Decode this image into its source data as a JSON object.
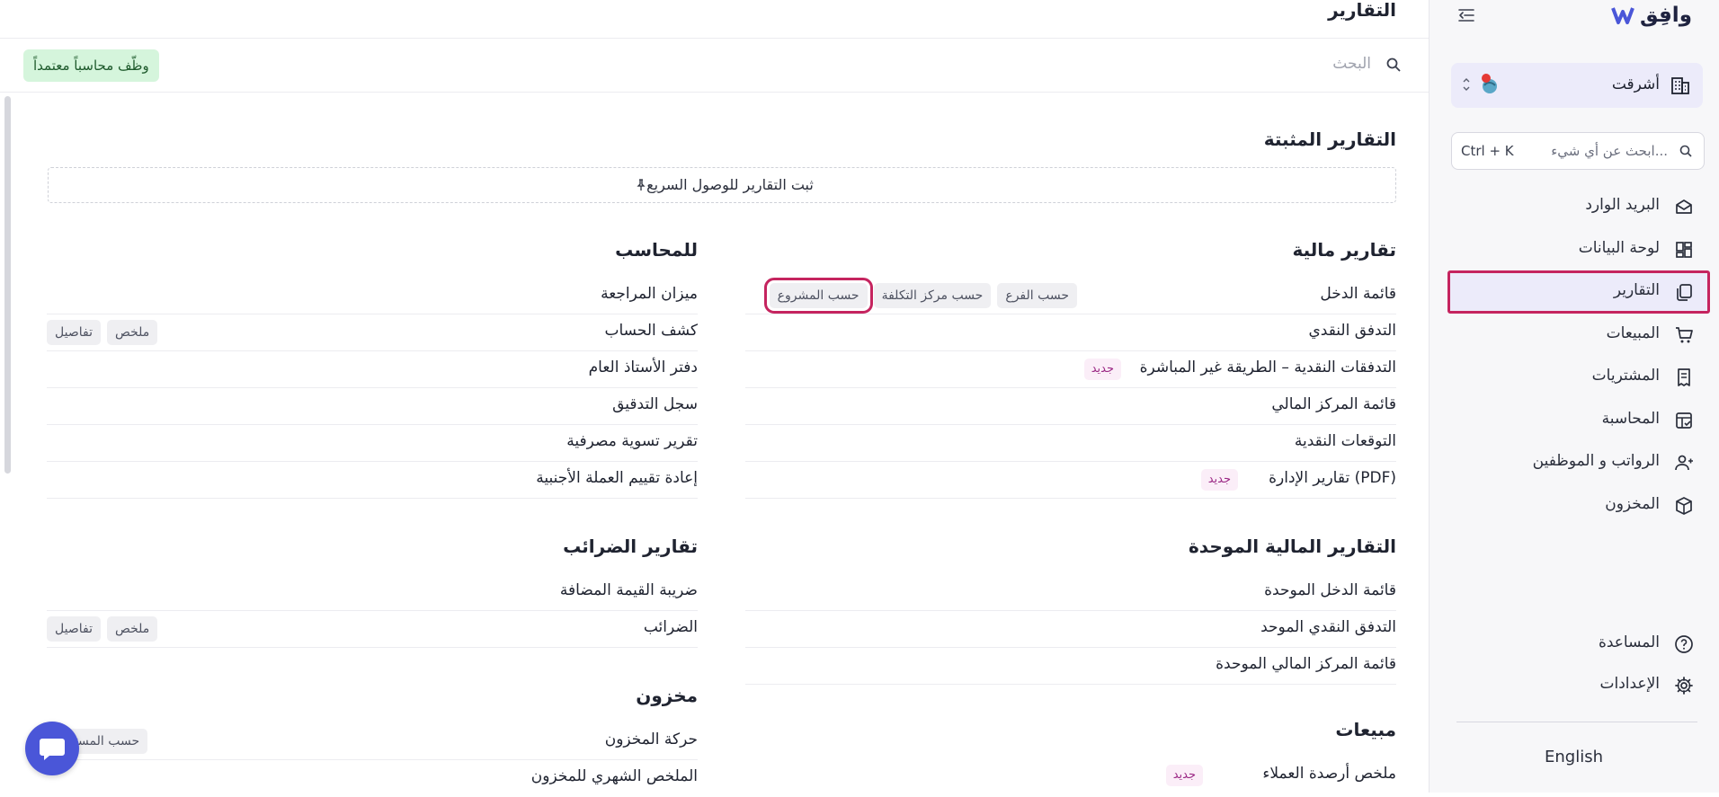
{
  "sidebar": {
    "brand": "وافِق",
    "org_name": "أشرقت",
    "search": {
      "placeholder": "ابحث عن أي شيء...",
      "shortcut": "Ctrl + K"
    },
    "items": [
      {
        "label": "البريد الوارد",
        "icon": "inbox-icon"
      },
      {
        "label": "لوحة البيانات",
        "icon": "dashboard-icon"
      },
      {
        "label": "التقارير",
        "icon": "reports-icon",
        "active": true
      },
      {
        "label": "المبيعات",
        "icon": "cart-icon"
      },
      {
        "label": "المشتريات",
        "icon": "receipt-icon"
      },
      {
        "label": "المحاسبة",
        "icon": "ledger-icon"
      },
      {
        "label": "الرواتب و الموظفين",
        "icon": "employees-icon"
      },
      {
        "label": "المخزون",
        "icon": "box-icon"
      }
    ],
    "bottom_items": [
      {
        "label": "المساعدة",
        "icon": "help-icon"
      },
      {
        "label": "الإعدادات",
        "icon": "gear-icon"
      }
    ],
    "language": "English"
  },
  "main": {
    "title": "التقارير",
    "search_placeholder": "البحث",
    "hire_button": "وظّف محاسباً معتمداً",
    "pinned": {
      "title": "التقارير المثبتة",
      "hint": "ثبت التقارير للوصول السريع"
    }
  },
  "sections": {
    "financial": {
      "title": "تقارير مالية",
      "rows": [
        {
          "label": "قائمة الدخل",
          "chips": [
            "حسب الفرع",
            "حسب مركز التكلفة",
            "حسب المشروع"
          ]
        },
        {
          "label": "التدفق النقدي"
        },
        {
          "label": "التدفقات النقدية – الطريقة غير المباشرة",
          "badge": "جديد"
        },
        {
          "label": "قائمة المركز المالي"
        },
        {
          "label": "التوقعات النقدية"
        },
        {
          "label": "تقارير الإدارة (PDF)",
          "badge": "جديد"
        }
      ]
    },
    "accountant": {
      "title": "للمحاسب",
      "rows": [
        {
          "label": "ميزان المراجعة"
        },
        {
          "label": "كشف الحساب",
          "chips": [
            "ملخص",
            "تفاصيل"
          ]
        },
        {
          "label": "دفتر الأستاذ العام"
        },
        {
          "label": "سجل التدقيق"
        },
        {
          "label": "تقرير تسوية مصرفية"
        },
        {
          "label": "إعادة تقييم العملة الأجنبية"
        }
      ]
    },
    "consolidated": {
      "title": "التقارير المالية الموحدة",
      "rows": [
        {
          "label": "قائمة الدخل الموحدة"
        },
        {
          "label": "التدفق النقدي الموحد"
        },
        {
          "label": "قائمة المركز المالي الموحدة"
        }
      ]
    },
    "tax": {
      "title": "تقارير الضرائب",
      "rows": [
        {
          "label": "ضريبة القيمة المضافة"
        },
        {
          "label": "الضرائب",
          "chips": [
            "ملخص",
            "تفاصيل"
          ]
        }
      ]
    },
    "inventory": {
      "title": "مخزون",
      "rows": [
        {
          "label": "حركة المخزون",
          "chips": [
            "حسب المستودع"
          ]
        },
        {
          "label": "الملخص الشهري للمخزون"
        }
      ]
    },
    "sales": {
      "title": "مبيعات",
      "rows": [
        {
          "label": "ملخص أرصدة العملاء",
          "badge": "جديد"
        }
      ]
    }
  },
  "colors": {
    "accent": "#4a56d8",
    "active_bg": "#ecebfa",
    "highlight": "#c5245f",
    "hire_bg": "#d5f5dc",
    "badge_text": "#9c2a86"
  }
}
